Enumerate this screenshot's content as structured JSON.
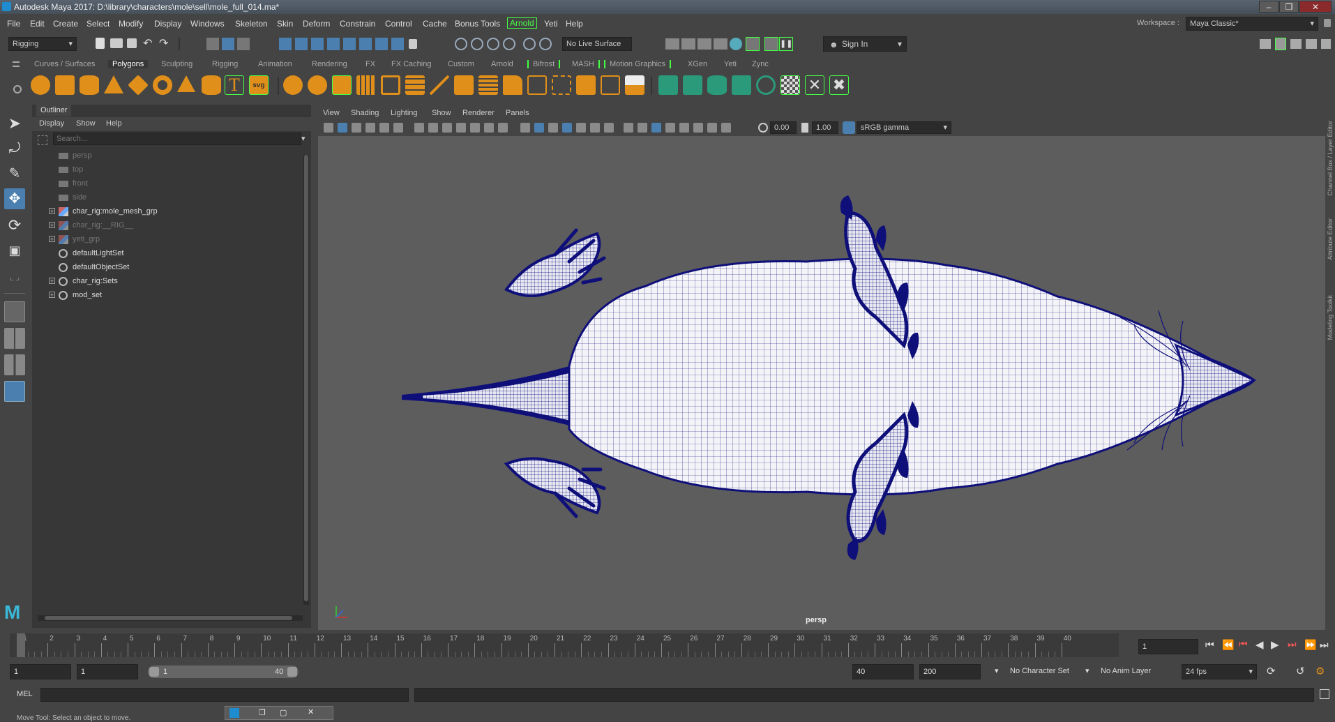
{
  "window": {
    "title": "Autodesk Maya 2017: D:\\library\\characters\\mole\\sell\\mole_full_014.ma*",
    "controls": [
      "–",
      "❐",
      "✕"
    ]
  },
  "menubar": {
    "items": [
      "File",
      "Edit",
      "Create",
      "Select",
      "Modify",
      "Display",
      "Windows",
      "Skeleton",
      "Skin",
      "Deform",
      "Constrain",
      "Control",
      "Cache",
      "Bonus Tools",
      "Arnold",
      "Yeti",
      "Help"
    ],
    "workspace_label": "Workspace :",
    "workspace_value": "Maya Classic*"
  },
  "statusline": {
    "menuset": "Rigging",
    "live_surface": "No Live Surface",
    "sign_in": "Sign In"
  },
  "shelf": {
    "tabs": [
      "Curves / Surfaces",
      "Polygons",
      "Sculpting",
      "Rigging",
      "Animation",
      "Rendering",
      "FX",
      "FX Caching",
      "Custom",
      "Arnold",
      "Bifrost",
      "MASH",
      "Motion Graphics",
      "XGen",
      "Yeti",
      "Zync"
    ],
    "active_tab": "Polygons"
  },
  "outliner": {
    "title": "Outliner",
    "menu": [
      "Display",
      "Show",
      "Help"
    ],
    "search_placeholder": "Search...",
    "items": [
      {
        "label": "persp",
        "dim": true,
        "icon": "camera-icon",
        "expandable": false
      },
      {
        "label": "top",
        "dim": true,
        "icon": "camera-icon",
        "expandable": false
      },
      {
        "label": "front",
        "dim": true,
        "icon": "camera-icon",
        "expandable": false
      },
      {
        "label": "side",
        "dim": true,
        "icon": "camera-icon",
        "expandable": false
      },
      {
        "label": "char_rig:mole_mesh_grp",
        "dim": false,
        "icon": "group-icon",
        "expandable": true
      },
      {
        "label": "char_rig:__RIG__",
        "dim": true,
        "icon": "group-icon",
        "expandable": true
      },
      {
        "label": "yeti_grp",
        "dim": true,
        "icon": "group-icon",
        "expandable": true
      },
      {
        "label": "defaultLightSet",
        "dim": false,
        "icon": "set-icon",
        "expandable": false
      },
      {
        "label": "defaultObjectSet",
        "dim": false,
        "icon": "set-icon",
        "expandable": false
      },
      {
        "label": "char_rig:Sets",
        "dim": false,
        "icon": "set-icon",
        "expandable": true
      },
      {
        "label": "mod_set",
        "dim": false,
        "icon": "set-icon",
        "expandable": true
      }
    ]
  },
  "viewport": {
    "menu": [
      "View",
      "Shading",
      "Lighting",
      "Show",
      "Renderer",
      "Panels"
    ],
    "exposure": "0.00",
    "gamma": "1.00",
    "color_space": "sRGB gamma",
    "camera_label": "persp",
    "side_tabs": [
      "Channel Box / Layer Editor",
      "Attribute Editor",
      "Modeling Toolkit"
    ]
  },
  "timeslider": {
    "ticks": [
      "1",
      "2",
      "3",
      "4",
      "5",
      "6",
      "7",
      "8",
      "9",
      "10",
      "11",
      "12",
      "13",
      "14",
      "15",
      "16",
      "17",
      "18",
      "19",
      "20",
      "21",
      "22",
      "23",
      "24",
      "25",
      "26",
      "27",
      "28",
      "29",
      "30",
      "31",
      "32",
      "33",
      "34",
      "35",
      "36",
      "37",
      "38",
      "39",
      "40"
    ],
    "current_frame": "1"
  },
  "range": {
    "start": "1",
    "inner_start": "1",
    "slider_start": "1",
    "slider_end": "40",
    "inner_end": "40",
    "end": "200",
    "character_set": "No Character Set",
    "anim_layer": "No Anim Layer",
    "fps": "24 fps"
  },
  "cmdline": {
    "label": "MEL"
  },
  "helpline": {
    "text": "Move Tool: Select an object to move."
  },
  "colors": {
    "wire": "#0f0f7a",
    "accent": "#4f4",
    "viewport_bg": "#5d5d5d",
    "active_tool": "#4a7fb0"
  }
}
